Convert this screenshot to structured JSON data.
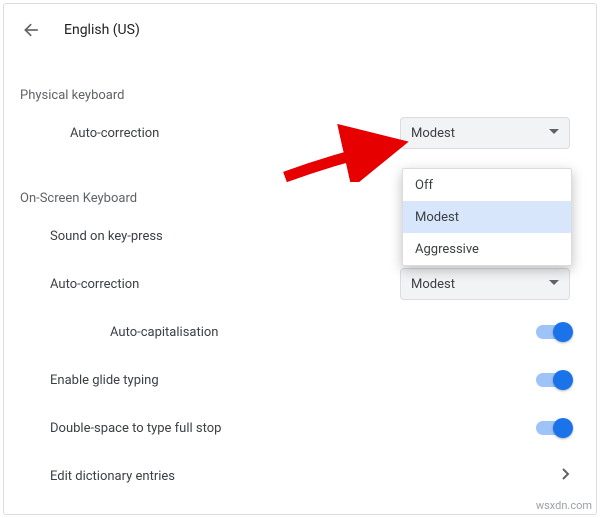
{
  "header": {
    "title": "English (US)"
  },
  "sections": {
    "physical": {
      "heading": "Physical keyboard",
      "auto_correction_label": "Auto-correction",
      "auto_correction_value": "Modest"
    },
    "onscreen": {
      "heading": "On-Screen Keyboard",
      "sound_label": "Sound on key-press",
      "auto_correction_label": "Auto-correction",
      "auto_correction_value": "Modest",
      "auto_cap_label": "Auto-capitalisation",
      "glide_label": "Enable glide typing",
      "double_space_label": "Double-space to type full stop",
      "dictionary_label": "Edit dictionary entries"
    }
  },
  "dropdown_menu": {
    "options": [
      "Off",
      "Modest",
      "Aggressive"
    ],
    "opt0": "Off",
    "opt1": "Modest",
    "opt2": "Aggressive",
    "selected_index": 1
  },
  "toggles": {
    "auto_cap": true,
    "glide": true,
    "double_space": true
  },
  "watermark": "wsxdn.com"
}
